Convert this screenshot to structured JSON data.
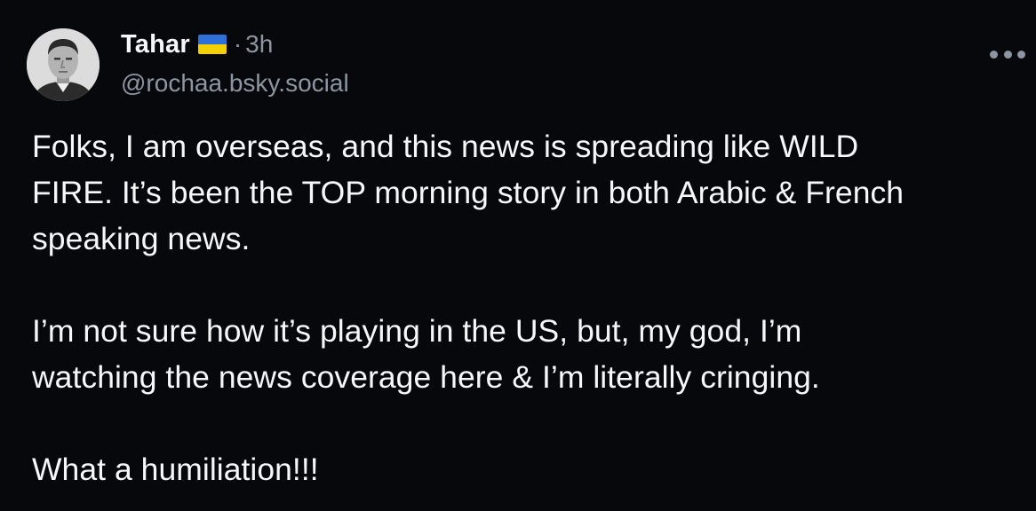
{
  "author": {
    "display_name": "Tahar",
    "flag_icon": "ukraine-flag-icon",
    "flag_colors": {
      "top": "#2f6fd8",
      "bottom": "#f5d000"
    },
    "separator": "·",
    "timestamp": "3h",
    "handle": "@rochaa.bsky.social"
  },
  "menu": {
    "icon": "more-horizontal-icon"
  },
  "post": {
    "paragraphs": [
      "Folks, I am overseas, and this news is spreading like WILD\nFIRE. It’s been the TOP morning story in both Arabic & French\nspeaking news.",
      "I’m not sure how it’s playing in the US, but, my god, I’m\nwatching the news coverage here & I’m literally cringing.",
      "What a humiliation!!!"
    ]
  },
  "colors": {
    "background": "#07080b",
    "text": "#f6f7f8",
    "muted": "#8c96a3"
  }
}
